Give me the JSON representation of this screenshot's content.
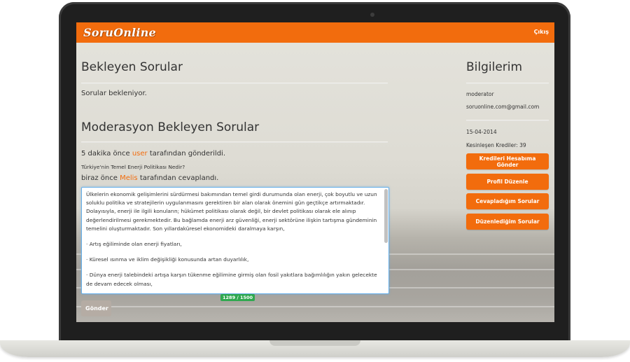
{
  "app": {
    "logo": "SoruOnline"
  },
  "nav": {
    "logout_label": "Çıkış"
  },
  "main": {
    "pending_title": "Bekleyen Sorular",
    "pending_message": "Sorular bekleniyor.",
    "moderation_title": "Moderasyon Bekleyen Sorular",
    "question": {
      "time": "5 dakika önce",
      "user": "user",
      "suffix": "tarafından gönderildi.",
      "text": "Türkiye'nin Temel Enerji Politikası Nedir?"
    },
    "answer_meta": {
      "time": "biraz önce",
      "user": "Melis",
      "suffix": "tarafından cevaplandı."
    },
    "editor_paragraphs": [
      "Ülkelerin ekonomik gelişimlerini sürdürmesi bakımından temel girdi durumunda olan enerji, çok boyutlu ve uzun soluklu politika ve stratejilerin uygulanmasını gerektiren bir alan olarak önemini gün geçtikçe artırmaktadır. Dolayısıyla, enerji ile ilgili konuların; hükümet politikası olarak değil, bir devlet politikası olarak ele alınıp değerlendirilmesi gerekmektedir. Bu bağlamda enerji arz güvenliği, enerji sektörüne ilişkin tartışma gündeminin temelini oluşturmaktadır. Son yıllardaküresel ekonomideki daralmaya karşın,",
      "·     Artış eğiliminde olan enerji fiyatları,",
      "·     Küresel ısınma ve iklim değişikliği konusunda artan duyarlılık,",
      "·     Dünya enerji talebindeki artışa karşın tükenme eğilimine girmiş olan fosil yakıtlara bağımlılığın yakın gelecekte de devam edecek olması,"
    ],
    "char_counter": "1289 / 1500",
    "submit_label": "Gönder"
  },
  "sidebar": {
    "title": "Bilgilerim",
    "role": "moderator",
    "email": "soruonline.com@gmail.com",
    "date": "15-04-2014",
    "credits": "Kesinleşen Krediler: 39",
    "buttons": [
      "Kredileri Hesabıma Gönder",
      "Profil Düzenle",
      "Cevapladığım Sorular",
      "Düzenlediğim Sorular"
    ]
  },
  "colors": {
    "brand": "#f26c0d",
    "counter": "#2fa84f",
    "submit": "#b5aca4"
  }
}
